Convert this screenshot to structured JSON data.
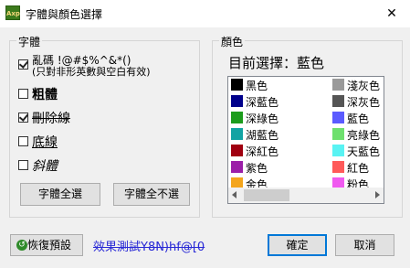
{
  "window": {
    "title": "字體與顏色選擇",
    "close_glyph": "✕",
    "app_icon_text": "Axp"
  },
  "font_group": {
    "legend": "字體",
    "options": [
      {
        "label": "亂碼 !@#$%^&*()",
        "sublabel": "(只對非形英數與空白有效)",
        "checked": true
      },
      {
        "label": "粗體",
        "checked": false
      },
      {
        "label": "刪除線",
        "checked": true
      },
      {
        "label": "底線",
        "checked": false
      },
      {
        "label": "斜體",
        "checked": false
      }
    ],
    "select_all_label": "字體全選",
    "deselect_all_label": "字體全不選"
  },
  "color_group": {
    "legend": "顏色",
    "current_selection": "目前選擇：藍色",
    "left_column": [
      {
        "name": "黑色",
        "color": "#000000"
      },
      {
        "name": "深藍色",
        "color": "#00008b"
      },
      {
        "name": "深綠色",
        "color": "#1c9c1c"
      },
      {
        "name": "湖藍色",
        "color": "#12a3a3"
      },
      {
        "name": "深紅色",
        "color": "#a00010"
      },
      {
        "name": "紫色",
        "color": "#9b1fa8"
      },
      {
        "name": "金色",
        "color": "#f4a51c"
      }
    ],
    "right_column": [
      {
        "name": "淺灰色",
        "color": "#9a9a9a"
      },
      {
        "name": "深灰色",
        "color": "#555555"
      },
      {
        "name": "藍色",
        "color": "#5b5bff"
      },
      {
        "name": "亮綠色",
        "color": "#6ee06e"
      },
      {
        "name": "天藍色",
        "color": "#59f3f3"
      },
      {
        "name": "紅色",
        "color": "#ff5a5a"
      },
      {
        "name": "粉色",
        "color": "#f05af0"
      }
    ]
  },
  "footer": {
    "restore_label": "恢復預設",
    "preview_text": "效果測試Y8N)hf@[0",
    "ok_label": "確定",
    "cancel_label": "取消"
  }
}
